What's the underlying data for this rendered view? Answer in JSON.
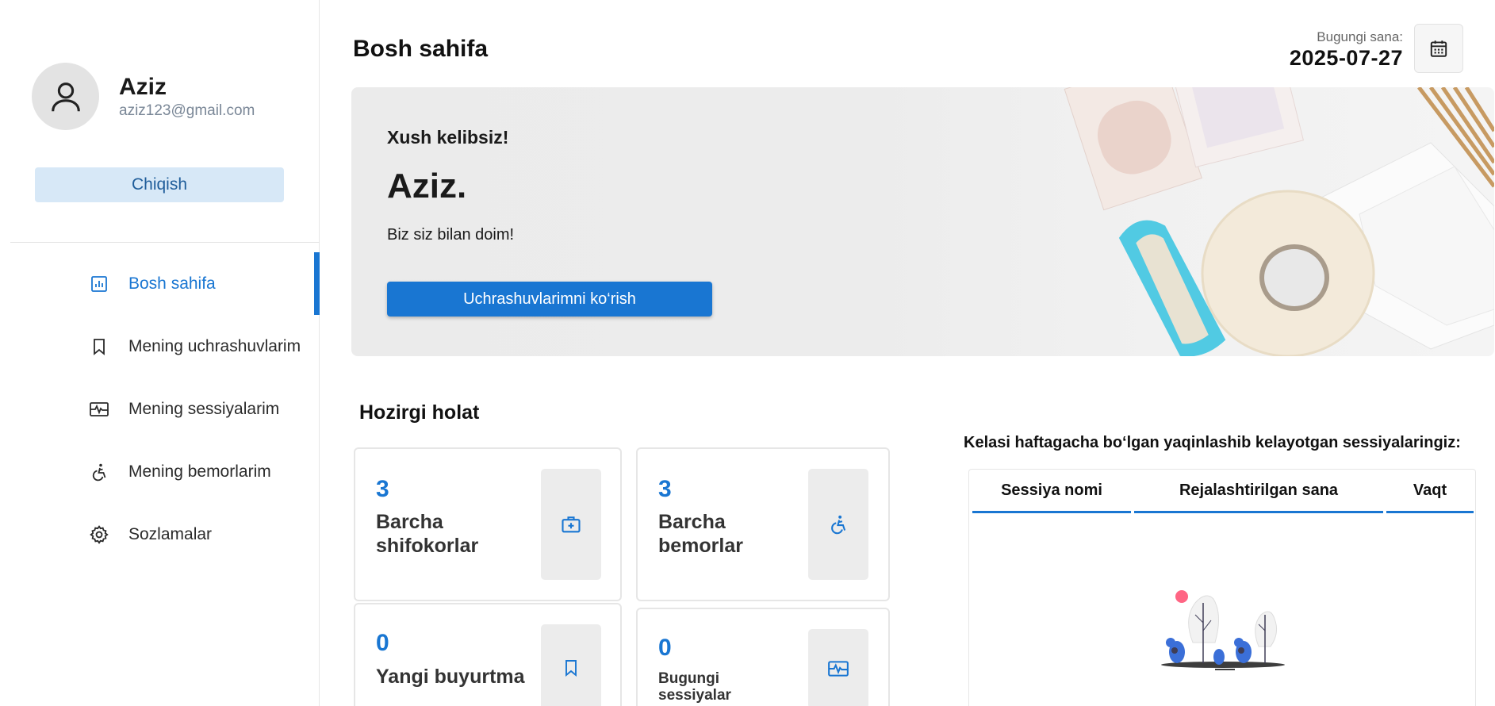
{
  "user": {
    "name": "Aziz",
    "email": "aziz123@gmail.com"
  },
  "logout_label": "Chiqish",
  "nav": [
    {
      "label": "Bosh sahifa",
      "icon": "chart-icon",
      "active": true
    },
    {
      "label": "Mening uchrashuvlarim",
      "icon": "bookmark-icon",
      "active": false
    },
    {
      "label": "Mening sessiyalarim",
      "icon": "pulse-icon",
      "active": false
    },
    {
      "label": "Mening bemorlarim",
      "icon": "accessible-icon",
      "active": false
    },
    {
      "label": "Sozlamalar",
      "icon": "gear-icon",
      "active": false
    }
  ],
  "header": {
    "title": "Bosh sahifa",
    "date_label": "Bugungi sana:",
    "date_value": "2025-07-27"
  },
  "hero": {
    "greeting": "Xush kelibsiz!",
    "name": "Aziz.",
    "subtitle": "Biz siz bilan doim!",
    "button_label": "Uchrashuvlarimni ko‘rish"
  },
  "status": {
    "title": "Hozirgi holat",
    "cards": [
      {
        "value": "3",
        "label": "Barcha shifokorlar",
        "icon": "medical-bag-icon"
      },
      {
        "value": "3",
        "label": "Barcha bemorlar",
        "icon": "accessible-icon"
      },
      {
        "value": "0",
        "label": "Yangi buyurtma",
        "icon": "bookmark-icon"
      },
      {
        "value": "0",
        "label": "Bugungi sessiyalar",
        "icon": "pulse-icon"
      }
    ]
  },
  "upcoming": {
    "title": "Kelasi haftagacha bo‘lgan yaqinlashib kelayotgan sessiyalaringiz:",
    "columns": [
      "Sessiya nomi",
      "Rejalashtirilgan sana",
      "Vaqt"
    ]
  },
  "colors": {
    "primary": "#1976d2",
    "logout_bg": "#d7e8f7",
    "card_border": "#e6e6e6"
  }
}
